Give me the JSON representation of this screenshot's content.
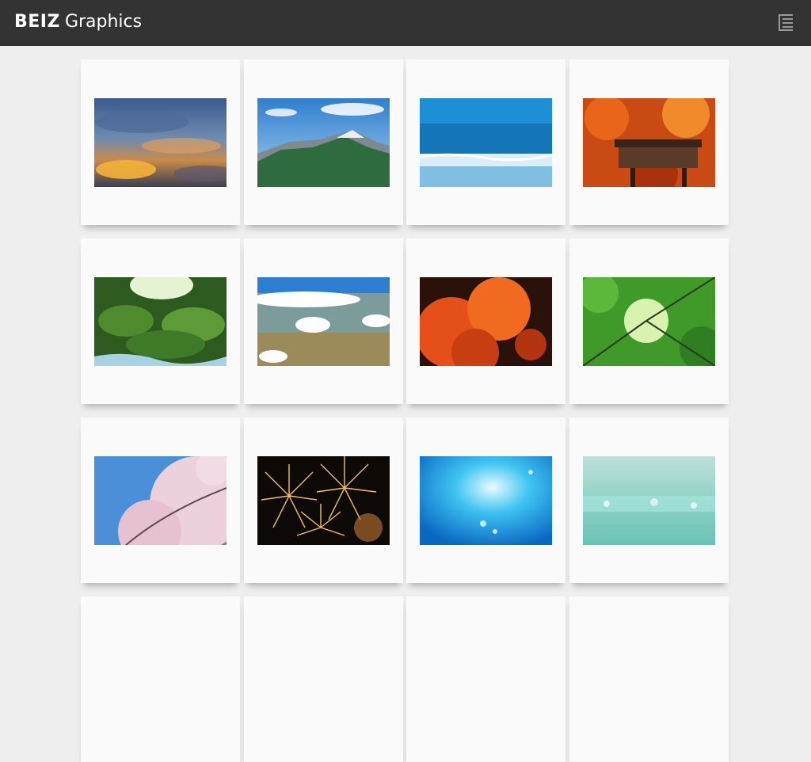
{
  "header": {
    "brand": "BEIZ",
    "word": "Graphics",
    "menu_icon": "list-menu-icon"
  },
  "grid": {
    "columns": 4,
    "items": [
      {
        "name": "sunset-sky-icon",
        "kind": "sunset"
      },
      {
        "name": "mountain-range-icon",
        "kind": "mountain"
      },
      {
        "name": "ocean-waves-icon",
        "kind": "ocean"
      },
      {
        "name": "autumn-temple-icon",
        "kind": "temple"
      },
      {
        "name": "mossy-stream-icon",
        "kind": "moss"
      },
      {
        "name": "aerial-clouds-icon",
        "kind": "aerial"
      },
      {
        "name": "red-maple-leaves-icon",
        "kind": "maple"
      },
      {
        "name": "green-canopy-icon",
        "kind": "canopy"
      },
      {
        "name": "cherry-blossom-icon",
        "kind": "sakura"
      },
      {
        "name": "fireworks-icon",
        "kind": "fireworks"
      },
      {
        "name": "underwater-light-icon",
        "kind": "water"
      },
      {
        "name": "teal-bokeh-icon",
        "kind": "bokeh"
      },
      {
        "name": "placeholder-card",
        "kind": "empty"
      },
      {
        "name": "placeholder-card",
        "kind": "empty"
      },
      {
        "name": "placeholder-card",
        "kind": "empty"
      },
      {
        "name": "placeholder-card",
        "kind": "empty"
      }
    ]
  },
  "colors": {
    "header_bg": "#333333",
    "page_bg": "#eeeeee",
    "card_bg": "#fafafa"
  }
}
